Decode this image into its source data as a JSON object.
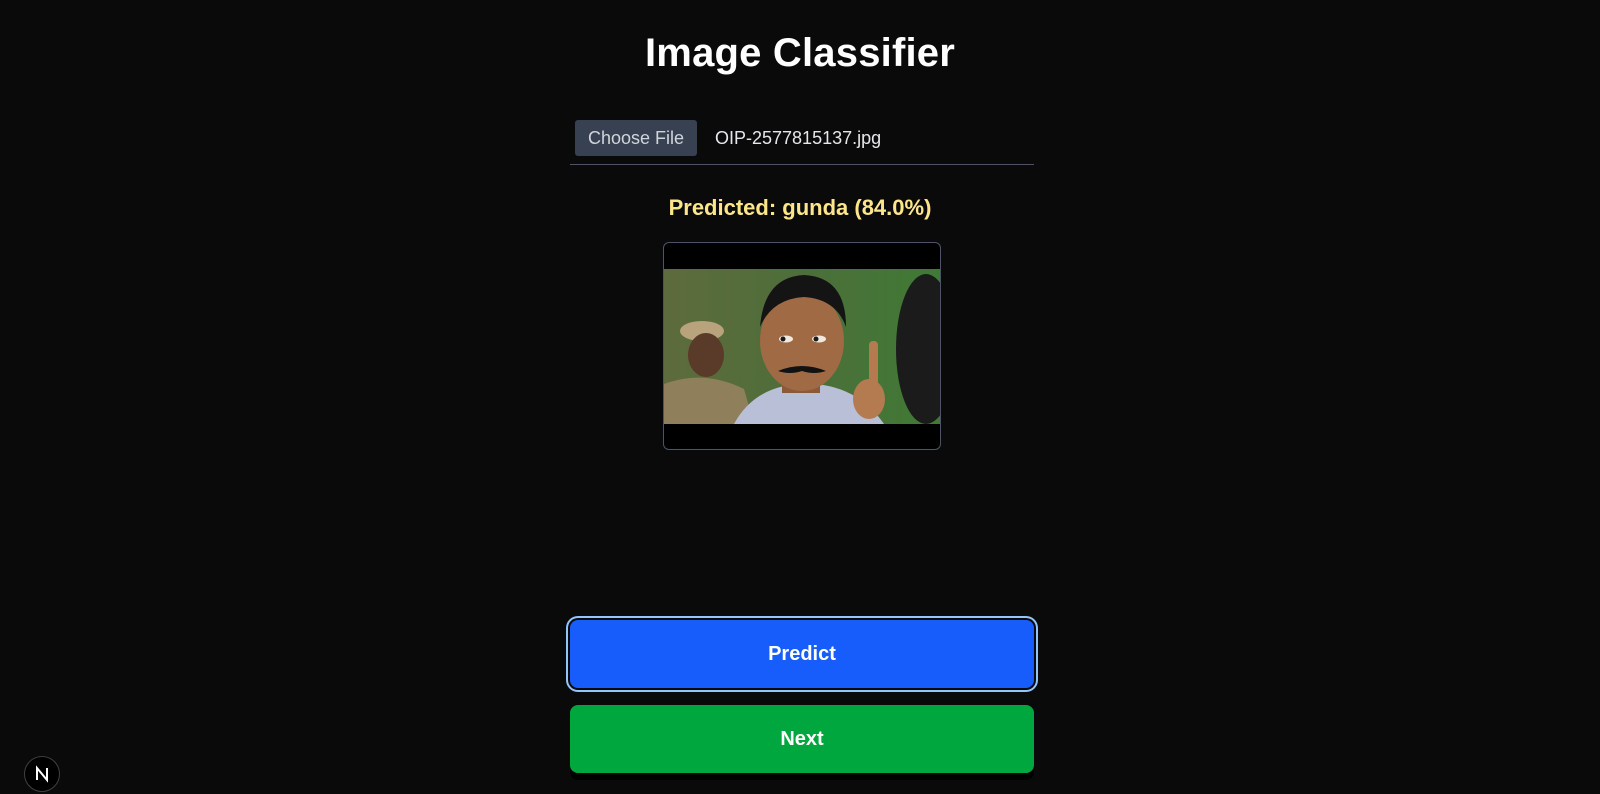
{
  "page": {
    "title": "Image Classifier"
  },
  "file_input": {
    "button_label": "Choose File",
    "file_name": "OIP-2577815137.jpg"
  },
  "prediction": {
    "text": "Predicted: gunda (84.0%)",
    "label": "gunda",
    "confidence_percent": 84.0
  },
  "preview": {
    "alt": "uploaded image preview"
  },
  "actions": {
    "predict_label": "Predict",
    "next_label": "Next"
  },
  "dev_badge": {
    "icon": "nextjs-n-icon",
    "letter": "N"
  },
  "colors": {
    "background": "#0a0a0a",
    "prediction_text": "#fde68a",
    "predict_button": "#165dfb",
    "next_button": "#00a63e",
    "choose_file_button": "#374151"
  }
}
